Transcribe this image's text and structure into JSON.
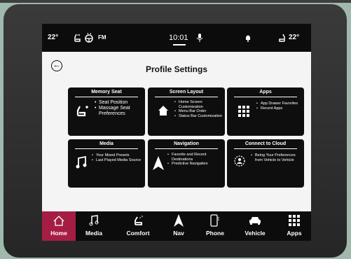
{
  "status_bar": {
    "temp_left": "22°",
    "radio_band": "FM",
    "clock": "10:01",
    "temp_right": "22°"
  },
  "page": {
    "title": "Profile Settings"
  },
  "cards": [
    {
      "title": "Memory Seat",
      "items": [
        "Seat Position",
        "Massage Seat Preferences"
      ],
      "icon": "seat-icon"
    },
    {
      "title": "Screen Layout",
      "items": [
        "Home Screen Customization",
        "Menu Bar Order",
        "Status Bar Customization"
      ],
      "icon": "home-icon"
    },
    {
      "title": "Apps",
      "items": [
        "App Drawer Favorites",
        "Recent Apps"
      ],
      "icon": "grid-icon"
    },
    {
      "title": "Media",
      "items": [
        "Your Mixed Presets",
        "Last Played Media Source"
      ],
      "icon": "music-note-icon"
    },
    {
      "title": "Navigation",
      "items": [
        "Favorite and Recent Destinations",
        "Predictive Navigation"
      ],
      "icon": "navigation-arrow-icon"
    },
    {
      "title": "Connect to Cloud",
      "items": [
        "Being Your Preferences from Vehicle to Vehicle"
      ],
      "icon": "cloud-profile-icon"
    }
  ],
  "nav": [
    {
      "label": "Home",
      "icon": "home-outline-icon",
      "active": true
    },
    {
      "label": "Media",
      "icon": "music-note-icon",
      "active": false
    },
    {
      "label": "Comfort",
      "icon": "heated-seat-icon",
      "active": false
    },
    {
      "label": "Nav",
      "icon": "navigation-arrow-icon",
      "active": false
    },
    {
      "label": "Phone",
      "icon": "phone-icon",
      "active": false
    },
    {
      "label": "Vehicle",
      "icon": "car-icon",
      "active": false
    },
    {
      "label": "Apps",
      "icon": "grid-icon",
      "active": false
    }
  ],
  "colors": {
    "active_nav": "#a61d44",
    "card_bg": "#0e0e0e",
    "screen_bg": "#f4f4f4"
  }
}
